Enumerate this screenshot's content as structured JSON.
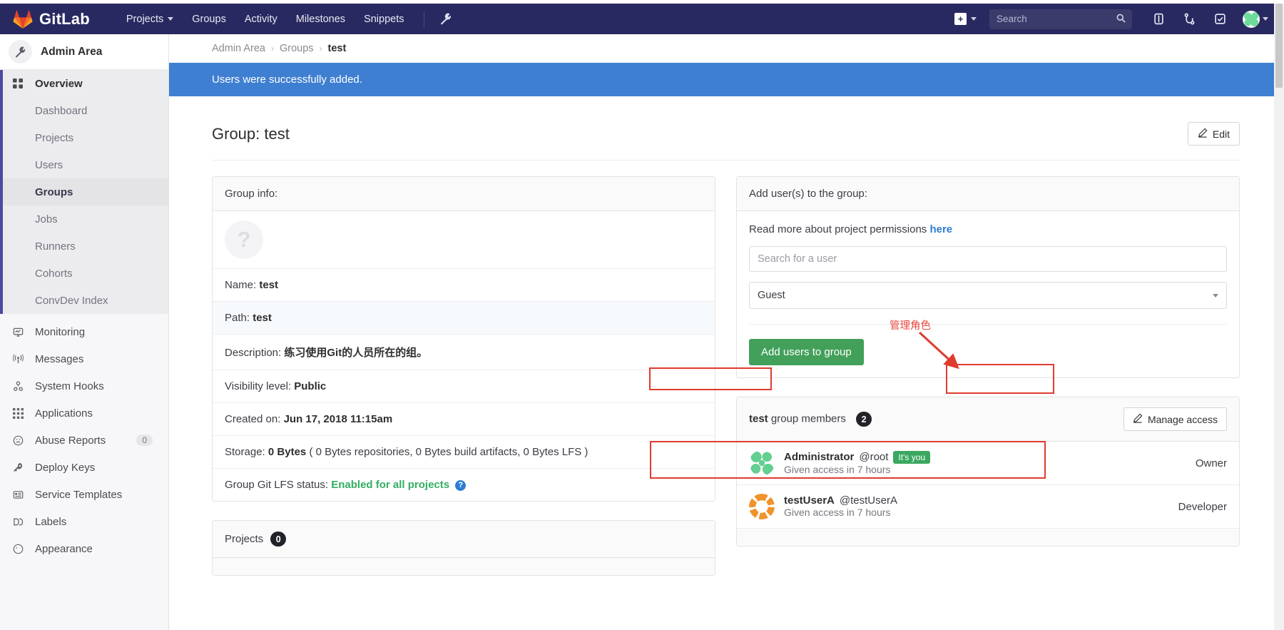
{
  "topnav": {
    "brand": "GitLab",
    "links": [
      {
        "label": "Projects",
        "has_caret": true
      },
      {
        "label": "Groups",
        "has_caret": false
      },
      {
        "label": "Activity",
        "has_caret": false
      },
      {
        "label": "Milestones",
        "has_caret": false
      },
      {
        "label": "Snippets",
        "has_caret": false
      }
    ],
    "wrench_icon": "wrench-icon",
    "plus_label": "+",
    "search_placeholder": "Search",
    "icons": [
      "issues-icon",
      "merge-requests-icon",
      "todos-icon"
    ]
  },
  "sidebar": {
    "header": "Admin Area",
    "overview": "Overview",
    "sub_items": [
      {
        "label": "Dashboard"
      },
      {
        "label": "Projects"
      },
      {
        "label": "Users"
      },
      {
        "label": "Groups"
      },
      {
        "label": "Jobs"
      },
      {
        "label": "Runners"
      },
      {
        "label": "Cohorts"
      },
      {
        "label": "ConvDev Index"
      }
    ],
    "active_sub": "Groups",
    "items": [
      {
        "label": "Monitoring",
        "badge": ""
      },
      {
        "label": "Messages",
        "badge": ""
      },
      {
        "label": "System Hooks",
        "badge": ""
      },
      {
        "label": "Applications",
        "badge": ""
      },
      {
        "label": "Abuse Reports",
        "badge": "0"
      },
      {
        "label": "Deploy Keys",
        "badge": ""
      },
      {
        "label": "Service Templates",
        "badge": ""
      },
      {
        "label": "Labels",
        "badge": ""
      },
      {
        "label": "Appearance",
        "badge": ""
      }
    ]
  },
  "breadcrumb": {
    "item1": "Admin Area",
    "item2": "Groups",
    "current": "test",
    "sep": "›"
  },
  "alert": {
    "message": "Users were successfully added."
  },
  "page": {
    "title": "Group: test",
    "edit_label": "Edit"
  },
  "group_info": {
    "header": "Group info:",
    "rows": [
      {
        "label": "Name:",
        "value": "test"
      },
      {
        "label": "Path:",
        "value": "test"
      },
      {
        "label": "Description:",
        "value": "练习使用Git的人员所在的组。"
      },
      {
        "label": "Visibility level:",
        "value": "Public"
      },
      {
        "label": "Created on:",
        "value": "Jun 17, 2018 11:15am"
      }
    ],
    "storage_label": "Storage:",
    "storage_value": "0 Bytes",
    "storage_detail": "( 0 Bytes repositories, 0 Bytes build artifacts, 0 Bytes LFS )",
    "lfs_label": "Group Git LFS status:",
    "lfs_value": "Enabled for all projects",
    "help_icon": "?"
  },
  "projects_panel": {
    "title": "Projects",
    "count": "0"
  },
  "add_users": {
    "header": "Add user(s) to the group:",
    "perm_text": "Read more about project permissions",
    "perm_link": "here",
    "search_placeholder": "Search for a user",
    "access_level": "Guest",
    "submit_label": "Add users to group"
  },
  "members": {
    "title_bold": "test",
    "title_rest": " group members",
    "count": "2",
    "manage_label": "Manage access",
    "rows": [
      {
        "name": "Administrator",
        "handle": "@root",
        "badge": "It's you",
        "sub": "Given access in 7 hours",
        "role": "Owner",
        "avatar": "green"
      },
      {
        "name": "testUserA",
        "handle": "@testUserA",
        "badge": "",
        "sub": "Given access in 7 hours",
        "role": "Developer",
        "avatar": "orange"
      }
    ]
  },
  "annotations": {
    "manage_role_text": "管理角色"
  },
  "colors": {
    "nav_bg": "#292961",
    "alert_bg": "#3f7fd1",
    "green_button": "#42a05a",
    "link_blue": "#2d7dd2",
    "annotation_red": "#e03b2f",
    "lfs_green": "#31ad63"
  }
}
